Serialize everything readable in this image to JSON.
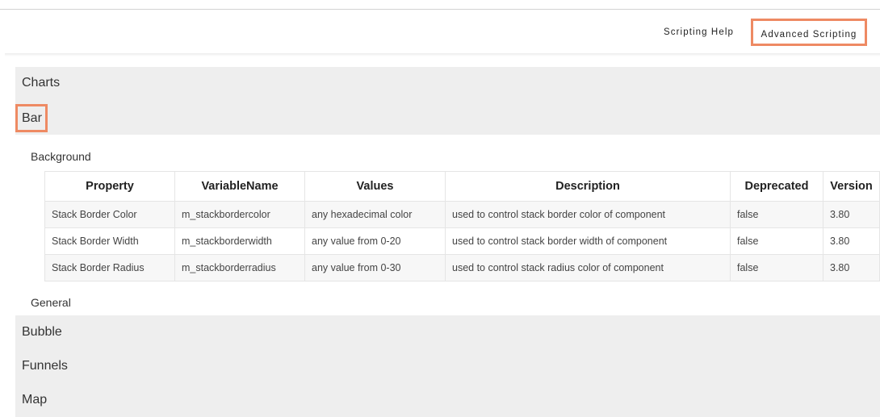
{
  "header": {
    "links": [
      {
        "label": "Scripting Help"
      },
      {
        "label": "Advanced Scripting"
      }
    ]
  },
  "sections": {
    "charts": "Charts",
    "bar": "Bar",
    "bubble": "Bubble",
    "funnels": "Funnels",
    "map": "Map"
  },
  "bar_groups": {
    "background": "Background",
    "general": "General"
  },
  "table": {
    "columns": [
      "Property",
      "VariableName",
      "Values",
      "Description",
      "Deprecated",
      "Version"
    ],
    "rows": [
      [
        "Stack Border Color",
        "m_stackbordercolor",
        "any hexadecimal color",
        "used to control stack border color of component",
        "false",
        "3.80"
      ],
      [
        "Stack Border Width",
        "m_stackborderwidth",
        "any value from 0-20",
        "used to control stack border width of component",
        "false",
        "3.80"
      ],
      [
        "Stack Border Radius",
        "m_stackborderradius",
        "any value from 0-30",
        "used to control stack radius color of component",
        "false",
        "3.80"
      ]
    ]
  },
  "colors": {
    "highlight": "#ee8a63",
    "section_bg": "#eeeeee"
  }
}
